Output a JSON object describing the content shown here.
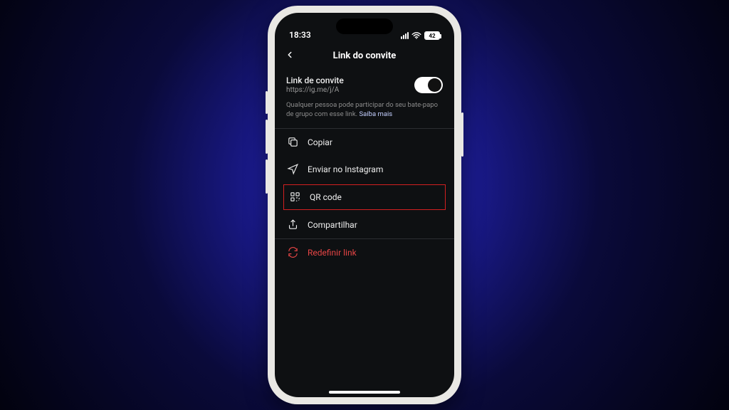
{
  "status": {
    "time": "18:33",
    "battery": "42"
  },
  "header": {
    "title": "Link do convite"
  },
  "invite": {
    "label": "Link de convite",
    "url": "https://ig.me/j/A",
    "description_prefix": "Qualquer pessoa pode participar do seu bate-papo de grupo com esse link. ",
    "learn_more": "Saiba mais"
  },
  "menu": {
    "copy": "Copiar",
    "send": "Enviar no Instagram",
    "qr": "QR code",
    "share": "Compartilhar",
    "reset": "Redefinir link"
  }
}
